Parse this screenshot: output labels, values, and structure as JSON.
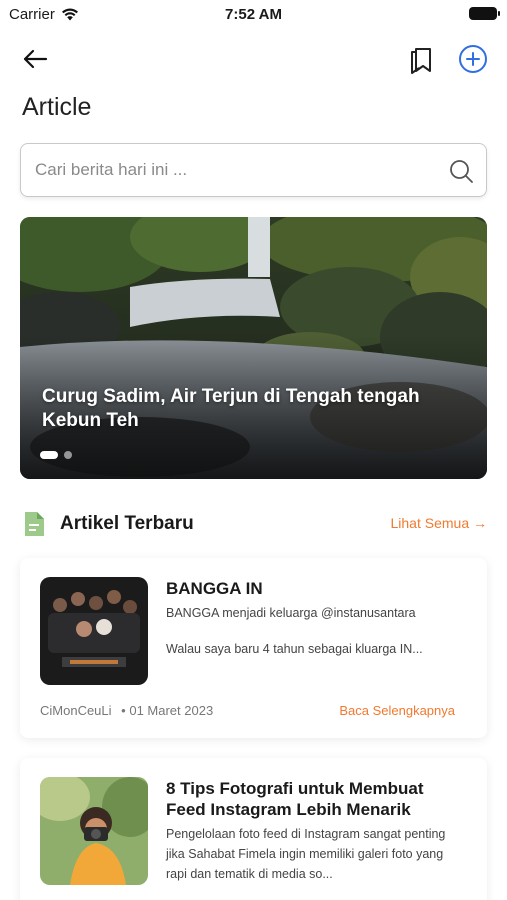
{
  "status": {
    "carrier": "Carrier",
    "time": "7:52 AM"
  },
  "header": {
    "title": "Article"
  },
  "search": {
    "placeholder": "Cari berita hari ini ..."
  },
  "hero": {
    "title": "Curug Sadim, Air Terjun di Tengah tengah Kebun Teh",
    "slide_count": 2,
    "active_slide": 1
  },
  "section": {
    "title": "Artikel Terbaru",
    "see_all": "Lihat Semua →"
  },
  "articles": [
    {
      "title": "BANGGA IN",
      "line1": "BANGGA menjadi keluarga @instanusantara",
      "line2": "Walau saya baru 4 tahun sebagai kluarga IN...",
      "author": "CiMonCeuLi",
      "date": "• 01 Maret 2023",
      "read_more": "Baca Selengkapnya"
    },
    {
      "title": "8 Tips Fotografi untuk Membuat Feed Instagram Lebih Menarik",
      "line1": "Pengelolaan foto feed di Instagram sangat penting jika Sahabat Fimela ingin memiliki galeri foto yang rapi dan tematik di media so..."
    }
  ],
  "colors": {
    "accent": "#f07a30",
    "primary_blue": "#2f6fe0",
    "text": "#1a1a1a"
  }
}
